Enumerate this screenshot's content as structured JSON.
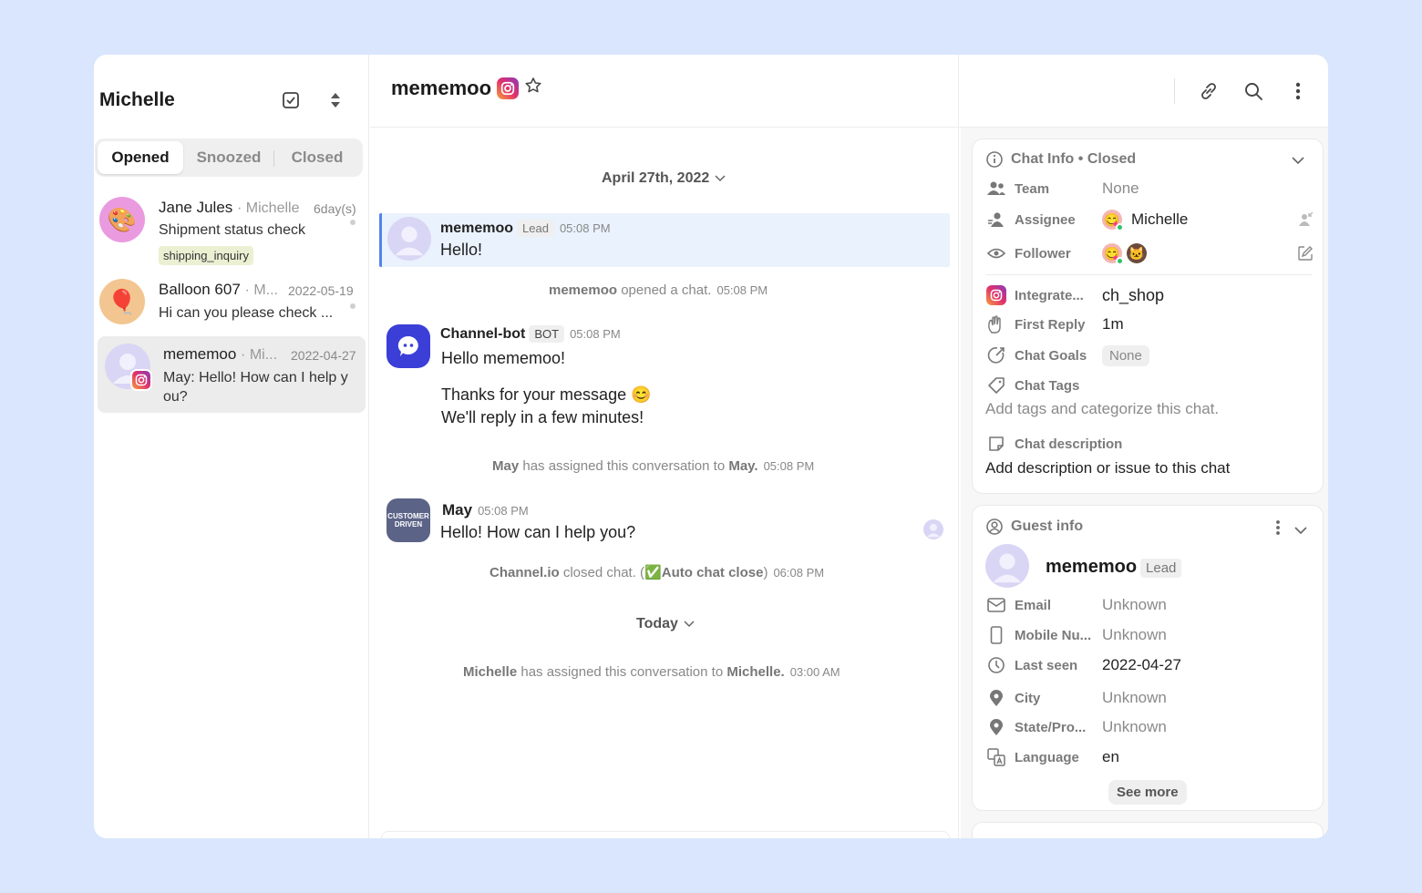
{
  "sidebar": {
    "title": "Michelle",
    "tabs": [
      "Opened",
      "Snoozed",
      "Closed"
    ],
    "conversations": [
      {
        "name": "Jane Jules",
        "sub": "· Michelle",
        "date": "6day(s)",
        "message": "Shipment status check",
        "tag": "shipping_inquiry",
        "avatar": "🎨"
      },
      {
        "name": "Balloon 607",
        "sub": "· M...",
        "date": "2022-05-19",
        "message": "Hi can you please check ...",
        "avatar": "🎈"
      },
      {
        "name": "mememoo",
        "sub": "· Mi...",
        "date": "2022-04-27",
        "message": "May: Hello! How can I help y ou?"
      }
    ]
  },
  "header": {
    "title": "mememoo"
  },
  "chat": {
    "date_divider": "April 27th, 2022",
    "today_divider": "Today",
    "messages": {
      "lead": {
        "sender": "mememoo",
        "badge": "Lead",
        "time": "05:08 PM",
        "text": "Hello!"
      },
      "sys_open": {
        "actor": "mememoo",
        "action": "opened a chat.",
        "time": "05:08 PM"
      },
      "bot": {
        "sender": "Channel-bot",
        "badge": "BOT",
        "time": "05:08 PM",
        "line1": "Hello mememoo!",
        "line2": "Thanks for your message 😊",
        "line3": "We'll reply in a few minutes!"
      },
      "sys_assign_may": {
        "actor": "May",
        "action": "has assigned this conversation to",
        "target": "May.",
        "time": "05:08 PM"
      },
      "may": {
        "sender": "May",
        "time": "05:08 PM",
        "text": "Hello! How can I help you?",
        "avatar_text": "CUSTOMER DRIVEN"
      },
      "sys_close": {
        "actor": "Channel.io",
        "action": "closed chat. (",
        "emoji": "✅",
        "detail": "Auto chat close",
        "suffix": ")",
        "time": "06:08 PM"
      },
      "sys_assign_michelle": {
        "actor": "Michelle",
        "action": "has assigned this conversation to",
        "target": "Michelle.",
        "time": "03:00 AM"
      }
    }
  },
  "chat_info": {
    "title": "Chat Info • Closed",
    "team": {
      "label": "Team",
      "value": "None"
    },
    "assignee": {
      "label": "Assignee",
      "value": "Michelle"
    },
    "follower": {
      "label": "Follower"
    },
    "integrated": {
      "label": "Integrate...",
      "value": "ch_shop"
    },
    "first_reply": {
      "label": "First Reply",
      "value": "1m"
    },
    "chat_goals": {
      "label": "Chat Goals",
      "value": "None"
    },
    "chat_tags": {
      "label": "Chat Tags",
      "placeholder": "Add tags and categorize this chat."
    },
    "chat_description": {
      "label": "Chat description",
      "placeholder": "Add description or issue to this chat"
    }
  },
  "guest_info": {
    "title": "Guest info",
    "name": "mememoo",
    "badge": "Lead",
    "email": {
      "label": "Email",
      "value": "Unknown"
    },
    "mobile": {
      "label": "Mobile Nu...",
      "value": "Unknown"
    },
    "last_seen": {
      "label": "Last seen",
      "value": "2022-04-27"
    },
    "city": {
      "label": "City",
      "value": "Unknown"
    },
    "state": {
      "label": "State/Pro...",
      "value": "Unknown"
    },
    "language": {
      "label": "Language",
      "value": "en"
    },
    "see_more": "See more"
  },
  "colors": {
    "accent": "#4f86e8",
    "highlight": "#eaf2fd",
    "bot": "#3b3fd8",
    "online": "#2ec36b",
    "background": "#d9e6fd"
  }
}
